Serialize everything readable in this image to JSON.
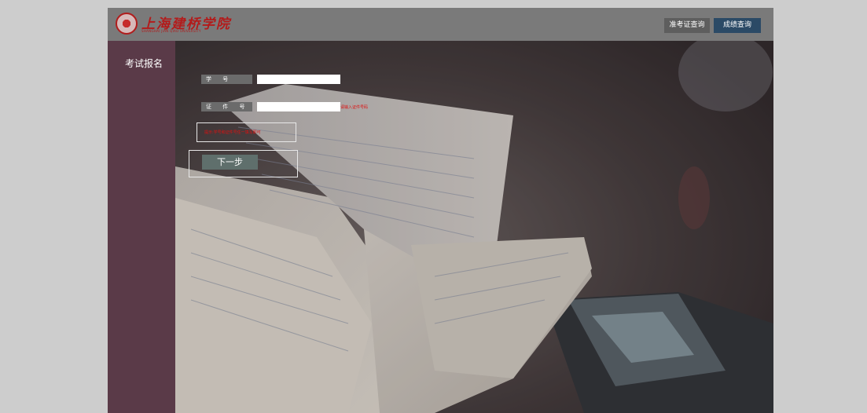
{
  "header": {
    "logo": {
      "name_cn": "上海建桥学院",
      "name_en": "SHANGHAI JIAN QIAO UNIVERSITY"
    },
    "nav": {
      "admission_ticket_query": "准考证查询",
      "score_query": "成绩查询"
    }
  },
  "sidebar": {
    "title": "考试报名"
  },
  "form": {
    "student_id_label": "学 号",
    "student_id_value": "",
    "id_number_label": "证 件 号",
    "id_number_value": "",
    "id_hint": "请输入证件号码",
    "notice": "提示:学号和证件号任一填写即可",
    "next_button": "下一步"
  },
  "colors": {
    "page_background": "#cdcdcd",
    "header_background": "#7a7a7a",
    "sidebar_background": "#5a3a48",
    "nav_active": "#2b4a66",
    "hint_red": "#e01010",
    "button_background": "#5f6f6c"
  },
  "icons": {
    "logo_seal": "university-seal-icon"
  }
}
